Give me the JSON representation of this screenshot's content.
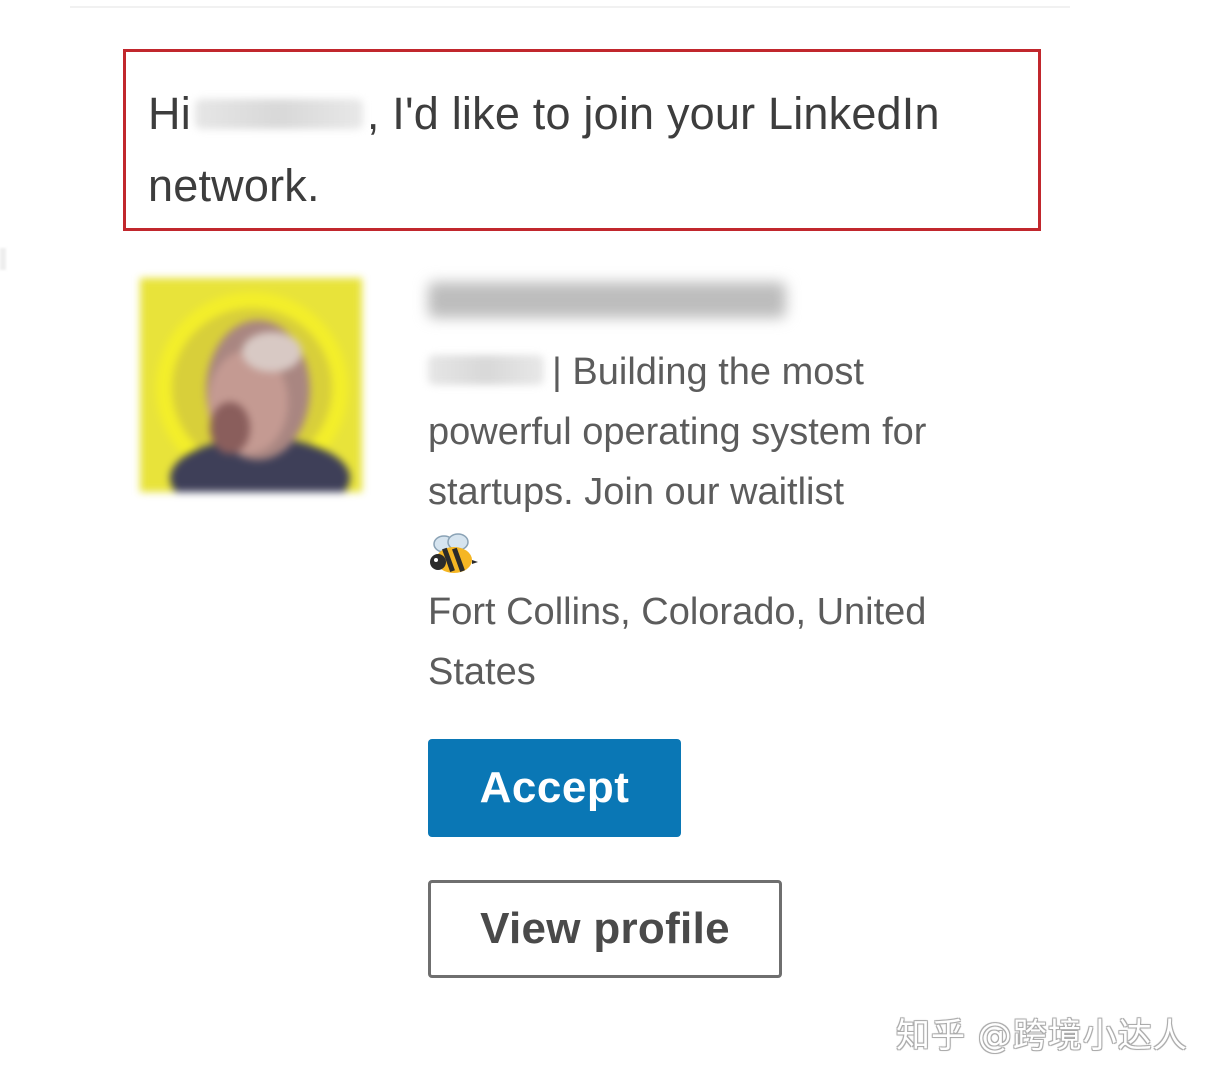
{
  "greeting": {
    "prefix": "Hi",
    "suffix": ", I'd like to join your LinkedIn",
    "line2": "network."
  },
  "profile": {
    "headline": "| Building the most powerful operating system for startups. Join our waitlist",
    "headline_emoji": "bee-emoji",
    "location": "Fort Collins, Colorado, United States"
  },
  "actions": {
    "accept_label": "Accept",
    "view_profile_label": "View profile"
  },
  "watermark": {
    "text": "知乎 @跨境小达人"
  },
  "colors": {
    "accept_bg": "#0a77b5",
    "highlight_border": "#c1272d",
    "avatar_ring": "#e9e432"
  }
}
